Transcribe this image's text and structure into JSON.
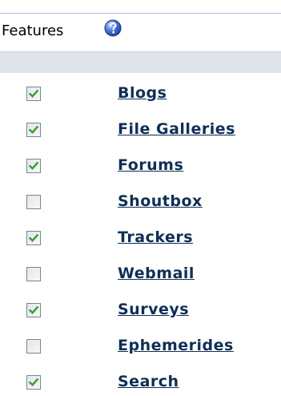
{
  "panel": {
    "title": "Features",
    "help_icon": "help-icon"
  },
  "colors": {
    "link": "#0e2f57",
    "check": "#2e9e2e",
    "subheader": "#dfe3ea",
    "rule": "#a9bcd6"
  },
  "features": [
    {
      "label": "Blogs",
      "checked": true
    },
    {
      "label": "File Galleries",
      "checked": true
    },
    {
      "label": "Forums",
      "checked": true
    },
    {
      "label": "Shoutbox",
      "checked": false
    },
    {
      "label": "Trackers",
      "checked": true
    },
    {
      "label": "Webmail",
      "checked": false
    },
    {
      "label": "Surveys",
      "checked": true
    },
    {
      "label": "Ephemerides",
      "checked": false
    },
    {
      "label": "Search",
      "checked": true
    }
  ]
}
